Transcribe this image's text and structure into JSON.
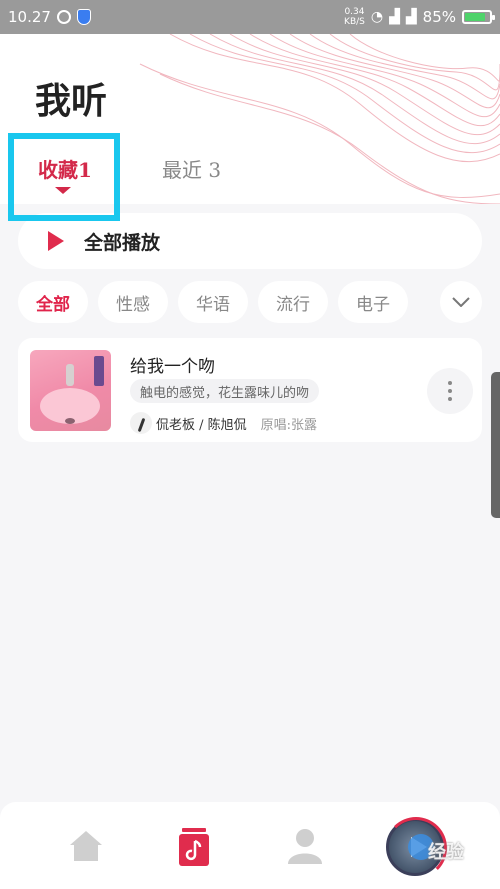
{
  "status_bar": {
    "time": "10.27",
    "net_speed_value": "0.34",
    "net_speed_unit": "KB/S",
    "battery": "85%"
  },
  "page_title": "我听",
  "tabs": [
    {
      "label": "收藏",
      "count": "1",
      "active": true
    },
    {
      "label": "最近",
      "count": "3",
      "active": false
    }
  ],
  "play_all_label": "全部播放",
  "filter_chips": [
    "全部",
    "性感",
    "华语",
    "流行",
    "电子"
  ],
  "song": {
    "title": "给我一个吻",
    "tag": "触电的感觉，花生露味儿的吻",
    "artist": "侃老板 / 陈旭侃",
    "original": "原唱:张露"
  },
  "watermark": "经验",
  "colors": {
    "accent": "#d3294a",
    "highlight": "#19c7ee"
  }
}
